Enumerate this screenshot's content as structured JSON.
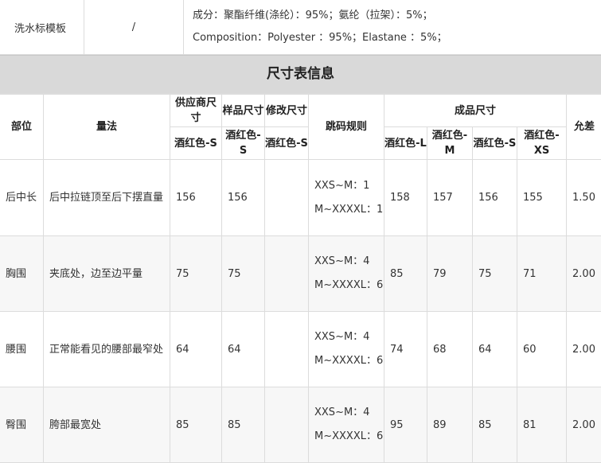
{
  "wash_label": {
    "title": "洗水标模板",
    "value": "/",
    "composition_cn": "成分：聚酯纤维(涤纶）：95%；氨纶（拉架）：5%；",
    "composition_en": "Composition：Polyester ：95%；Elastane ：5%；"
  },
  "size_table": {
    "title": "尺寸表信息",
    "headers": {
      "part": "部位",
      "method": "量法",
      "supplier_size": "供应商尺寸",
      "sample_size": "样品尺寸",
      "revised_size": "修改尺寸",
      "grading_rule": "跳码规则",
      "finished_size": "成品尺寸",
      "tolerance": "允差",
      "supplier_color": "酒红色-S",
      "sample_color": "酒红色-S",
      "revised_color": "酒红色-S",
      "fin_L": "酒红色-L",
      "fin_M": "酒红色-M",
      "fin_S": "酒红色-S",
      "fin_XS": "酒红色-XS"
    },
    "rows": [
      {
        "part": "后中长",
        "method": "后中拉链顶至后下摆直量",
        "supplier": "156",
        "sample": "156",
        "revised": "",
        "rule1": "XXS~M：1",
        "rule2": "M~XXXXL：1",
        "L": "158",
        "M": "157",
        "S": "156",
        "XS": "155",
        "tol": "1.50"
      },
      {
        "part": "胸围",
        "method": "夹底处，边至边平量",
        "supplier": "75",
        "sample": "75",
        "revised": "",
        "rule1": "XXS~M：4",
        "rule2": "M~XXXXL：6",
        "L": "85",
        "M": "79",
        "S": "75",
        "XS": "71",
        "tol": "2.00"
      },
      {
        "part": "腰围",
        "method": "正常能看见的腰部最窄处",
        "supplier": "64",
        "sample": "64",
        "revised": "",
        "rule1": "XXS~M：4",
        "rule2": "M~XXXXL：6",
        "L": "74",
        "M": "68",
        "S": "64",
        "XS": "60",
        "tol": "2.00"
      },
      {
        "part": "臀围",
        "method": "胯部最宽处",
        "supplier": "85",
        "sample": "85",
        "revised": "",
        "rule1": "XXS~M：4",
        "rule2": "M~XXXXL：6",
        "L": "95",
        "M": "89",
        "S": "85",
        "XS": "81",
        "tol": "2.00"
      }
    ]
  }
}
